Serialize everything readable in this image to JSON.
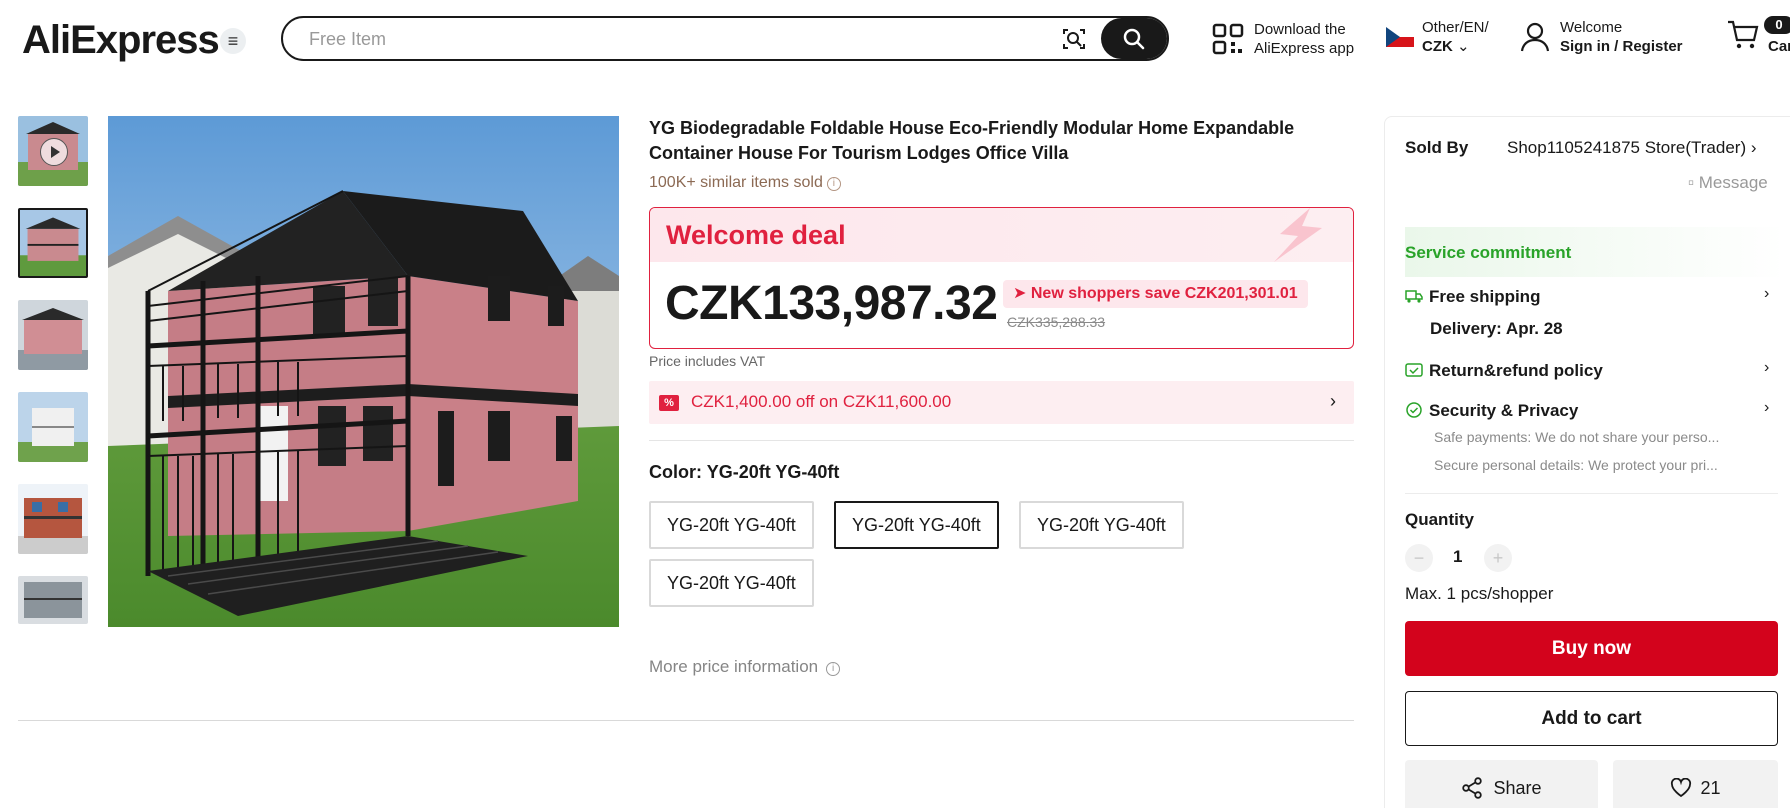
{
  "header": {
    "logo_text": "AliExpress",
    "search_placeholder": "Free Item",
    "app_line1": "Download the",
    "app_line2": "AliExpress app",
    "lang_line1": "Other/EN/",
    "lang_currency": "CZK",
    "user_line1": "Welcome",
    "user_line2": "Sign in / Register",
    "cart_count": "0",
    "cart_label": "Cart"
  },
  "product": {
    "title": "YG Biodegradable Foldable House Eco-Friendly Modular Home Expandable Container House For Tourism Lodges Office Villa",
    "sold_text": "100K+ similar items sold",
    "deal_title": "Welcome deal",
    "price": "CZK133,987.32",
    "save_text": "New shoppers save CZK201,301.01",
    "original_price": "CZK335,288.33",
    "vat_note": "Price includes VAT",
    "coupon_icon": "%",
    "coupon_text": "CZK1,400.00 off on CZK11,600.00",
    "color_label": "Color:",
    "color_value": "YG-20ft YG-40ft",
    "options": [
      "YG-20ft YG-40ft",
      "YG-20ft YG-40ft",
      "YG-20ft YG-40ft",
      "YG-20ft YG-40ft"
    ],
    "selected_option_index": 1,
    "more_price": "More price information"
  },
  "sidebar": {
    "sold_by_label": "Sold By",
    "store_name": "Shop1105241875 Store(Trader)",
    "message_label": "Message",
    "service_title": "Service commitment",
    "free_shipping": "Free shipping",
    "delivery": "Delivery: Apr. 28",
    "return_policy": "Return&refund policy",
    "security": "Security & Privacy",
    "security_sub1": "Safe payments: We do not share your perso...",
    "security_sub2": "Secure personal details: We protect your pri...",
    "quantity_label": "Quantity",
    "quantity_value": "1",
    "max_note": "Max. 1 pcs/shopper",
    "buy_now": "Buy now",
    "add_to_cart": "Add to cart",
    "share": "Share",
    "wishlist_count": "21"
  },
  "colors": {
    "accent_red": "#d3031c",
    "deal_red": "#e0213f",
    "service_green": "#29a329"
  }
}
